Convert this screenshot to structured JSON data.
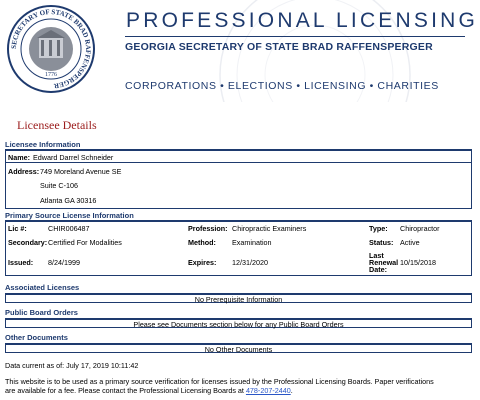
{
  "header": {
    "title": "PROFESSIONAL LICENSING",
    "subtitle": "GEORGIA SECRETARY OF STATE BRAD RAFFENSPERGER",
    "nav": "CORPORATIONS • ELECTIONS • LICENSING • CHARITIES",
    "seal_text": "SECRETARY OF STATE BRAD RAFFENSPERGER",
    "seal_year": "1776"
  },
  "page_title": "Licensee Details",
  "licensee": {
    "heading": "Licensee Information",
    "name_label": "Name:",
    "name_value": "Edward Darrel Schneider",
    "address_label": "Address:",
    "address_line1": "749 Moreland Avenue SE",
    "address_line2": "Suite C-106",
    "address_line3": "Atlanta GA 30316"
  },
  "primary": {
    "heading": "Primary Source License Information",
    "lic_label": "Lic #:",
    "lic_value": "CHIR006487",
    "profession_label": "Profession:",
    "profession_value": "Chiropractic Examiners",
    "type_label": "Type:",
    "type_value": "Chiropractor",
    "secondary_label": "Secondary:",
    "secondary_value": "Certified For Modalities",
    "method_label": "Method:",
    "method_value": "Examination",
    "status_label": "Status:",
    "status_value": "Active",
    "issued_label": "Issued:",
    "issued_value": "8/24/1999",
    "expires_label": "Expires:",
    "expires_value": "12/31/2020",
    "renewal_label_1": "Last",
    "renewal_label_2": "Renewal",
    "renewal_label_3": "Date:",
    "renewal_value": "10/15/2018"
  },
  "associated": {
    "heading": "Associated Licenses",
    "text": "No Prerequisite Information"
  },
  "board": {
    "heading": "Public Board Orders",
    "text": "Please see Documents section below for any Public Board Orders"
  },
  "other": {
    "heading": "Other Documents",
    "text": "No Other Documents"
  },
  "footer": {
    "data_current": "Data current as of: July 17, 2019 10:11:42",
    "disclaimer_1": "This website is to be used as a primary source verification for licenses issued by the Professional Licensing Boards. Paper verifications",
    "disclaimer_2": "are available for a fee. Please contact the Professional Licensing Boards at",
    "phone": "478-207-2440",
    "period": "."
  },
  "colors": {
    "brand_blue": "#1e3a6e",
    "title_red": "#9b1c1c",
    "link_blue": "#2a56c6"
  }
}
